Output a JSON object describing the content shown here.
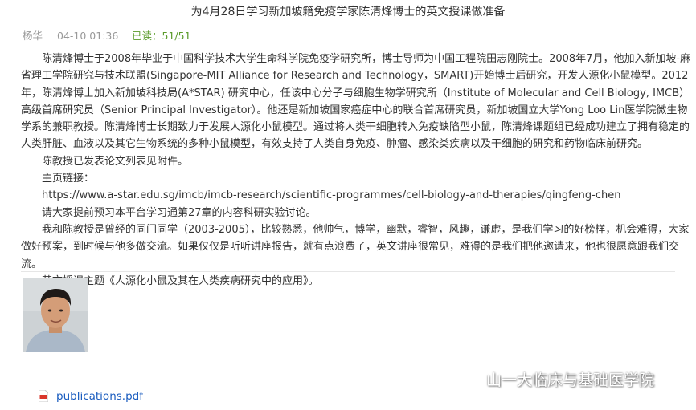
{
  "post": {
    "title": "为4月28日学习新加坡籍免疫学家陈清烽博士的英文授课做准备",
    "author": "杨华",
    "datetime": "04-10 01:36",
    "read_status": "已读：51/51"
  },
  "content": {
    "paragraphs": [
      "陈清烽博士于2008年毕业于中国科学技术大学生命科学院免疫学研究所，博士导师为中国工程院田志刚院士。2008年7月，他加入新加坡-麻省理工学院研究与技术联盟(Singapore-MIT Alliance for Research and Technology，SMART)开始博士后研究，开发人源化小鼠模型。2012年，陈清烽博士加入新加坡科技局(A*STAR) 研究中心，任该中心分子与细胞生物学研究所（Institute of Molecular and Cell Biology, IMCB）高级首席研究员（Senior Principal Investigator）。他还是新加坡国家癌症中心的联合首席研究员，新加坡国立大学Yong Loo Lin医学院微生物学系的兼职教授。陈清烽博士长期致力于发展人源化小鼠模型。通过将人类干细胞转入免疫缺陷型小鼠，陈清烽课题组已经成功建立了拥有稳定的人类肝脏、血液以及其它生物系统的多种小鼠模型，有效支持了人类自身免疫、肿瘤、感染类疾病以及干细胞的研究和药物临床前研究。",
      "陈教授已发表论文列表见附件。",
      "主页链接：",
      "https://www.a-star.edu.sg/imcb/imcb-research/scientific-programmes/cell-biology-and-therapies/qingfeng-chen",
      "请大家提前预习本平台学习通第27章的内容科研实验讨论。",
      "我和陈教授是曾经的同门同学（2003-2005），比较熟悉，他帅气，博学，幽默，睿智，风趣，谦虚，是我们学习的好榜样，机会难得，大家做好预案，到时候与他多做交流。如果仅仅是听听讲座报告，就有点浪费了，英文讲座很常见，难得的是我们把他邀请来，他也很愿意跟我们交流。",
      "英文授课主题《人源化小鼠及其在人类疾病研究中的应用》。"
    ]
  },
  "watermark": {
    "text": "山一大临床与基础医学院",
    "icon": "wechat-icon"
  },
  "attachment": {
    "filename": "publications.pdf",
    "icon": "pdf-icon"
  },
  "colors": {
    "meta_gray": "#999999",
    "read_green": "#5a9b2a",
    "link_blue": "#1a5cbf",
    "pdf_red": "#d9362b"
  }
}
